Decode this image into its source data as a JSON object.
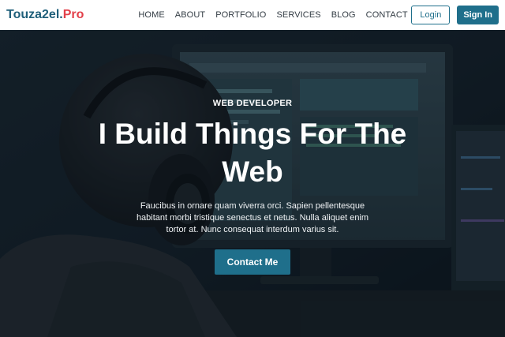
{
  "brand": {
    "name": "Touza2el.",
    "accent": "Pro",
    "color": "#1f5f7a",
    "accent_color": "#e2404a"
  },
  "nav": {
    "links": [
      {
        "label": "HOME"
      },
      {
        "label": "ABOUT"
      },
      {
        "label": "PORTFOLIO"
      },
      {
        "label": "SERVICES"
      },
      {
        "label": "BLOG"
      },
      {
        "label": "CONTACT"
      }
    ],
    "login_label": "Login",
    "signin_label": "Sign In"
  },
  "hero": {
    "eyebrow": "WEB DEVELOPER",
    "headline": "I Build Things For The Web",
    "subtext": "Faucibus in ornare quam viverra orci. Sapien pellentesque habitant morbi tristique senectus et netus. Nulla aliquet enim tortor at. Nunc consequat interdum varius sit.",
    "cta_label": "Contact Me"
  },
  "theme": {
    "primary": "#1f6f8b",
    "overlay": "#08121a"
  }
}
